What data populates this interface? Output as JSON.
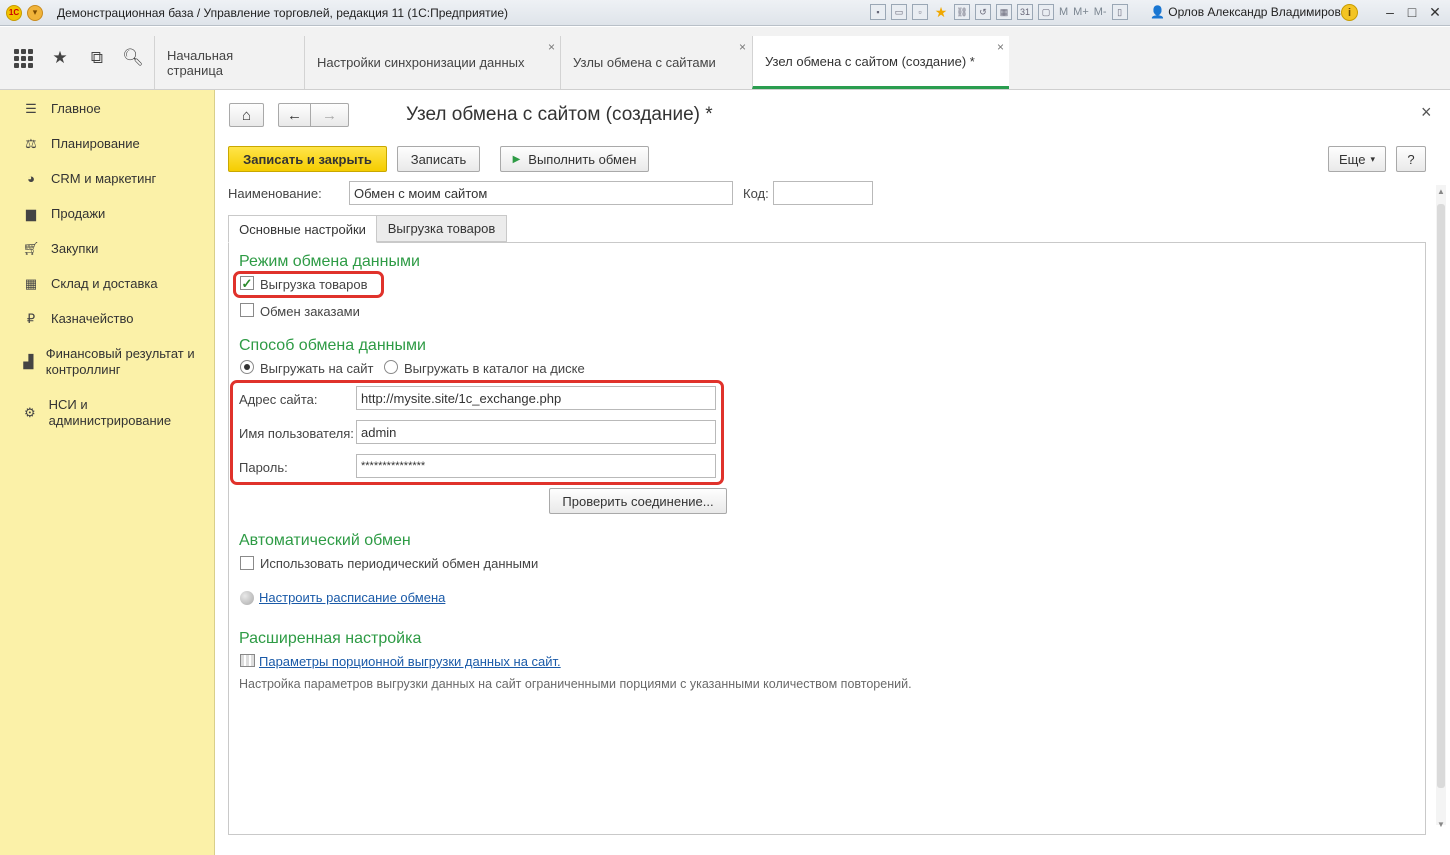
{
  "window": {
    "title": "Демонстрационная база / Управление торговлей, редакция 11  (1С:Предприятие)",
    "logo_text": "1С",
    "user": "Орлов Александр Владимирович",
    "info_label": "i",
    "tool_labels": {
      "m": "M",
      "mplus": "M+",
      "mminus": "M-",
      "calendar": "31"
    },
    "controls": {
      "minimize": "–",
      "maximize": "□",
      "close": "✕"
    }
  },
  "tabs": [
    {
      "label": "Начальная страница"
    },
    {
      "label": "Настройки синхронизации данных",
      "close": "×"
    },
    {
      "label": "Узлы обмена с сайтами",
      "close": "×"
    },
    {
      "label": "Узел обмена с сайтом (создание) *",
      "close": "×"
    }
  ],
  "sidebar": {
    "items": [
      {
        "label": "Главное"
      },
      {
        "label": "Планирование"
      },
      {
        "label": "CRM и маркетинг"
      },
      {
        "label": "Продажи"
      },
      {
        "label": "Закупки"
      },
      {
        "label": "Склад и доставка"
      },
      {
        "label": "Казначейство"
      },
      {
        "label": "Финансовый результат и контроллинг"
      },
      {
        "label": "НСИ и администрирование"
      }
    ]
  },
  "form": {
    "title": "Узел обмена с сайтом (создание) *",
    "close": "×",
    "nav": {
      "home": "⌂",
      "back": "←",
      "forward": "→"
    },
    "toolbar": {
      "save_close": "Записать и закрыть",
      "save": "Записать",
      "run_icon": "▶",
      "run": "Выполнить обмен",
      "more": "Еще",
      "more_arrow": "▾",
      "help": "?"
    },
    "name_label": "Наименование:",
    "name_value": "Обмен с моим сайтом",
    "code_label": "Код:",
    "code_value": "",
    "inner_tabs": [
      {
        "label": "Основные настройки"
      },
      {
        "label": "Выгрузка товаров"
      }
    ],
    "mode": {
      "title": "Режим обмена данными",
      "check_mark": "✓",
      "export_goods": {
        "label": "Выгрузка товаров",
        "checked": true
      },
      "exchange_orders": {
        "label": "Обмен заказами",
        "checked": false
      }
    },
    "method": {
      "title": "Способ обмена данными",
      "site": "Выгружать на сайт",
      "disk": "Выгружать в каталог на диске",
      "selected": "site"
    },
    "connection": {
      "address_label": "Адрес сайта:",
      "address_value": "http://mysite.site/1c_exchange.php",
      "user_label": "Имя пользователя:",
      "user_value": "admin",
      "password_label": "Пароль:",
      "password_value": "***************",
      "check_button": "Проверить соединение..."
    },
    "auto": {
      "title": "Автоматический обмен",
      "periodic": {
        "label": "Использовать периодический обмен данными",
        "checked": false
      },
      "schedule_link": "Настроить расписание обмена"
    },
    "advanced": {
      "title": "Расширенная настройка",
      "params_link": "Параметры порционной выгрузки данных на сайт.",
      "description": "Настройка параметров выгрузки данных на сайт ограниченными порциями с указанными количеством повторений."
    }
  },
  "colors": {
    "accent_green": "#2e9b45",
    "sidebar_bg": "#fbf1a8",
    "primary_button": "#f5cd00",
    "highlight_red": "#e0322b",
    "link_blue": "#1a5aa8"
  }
}
